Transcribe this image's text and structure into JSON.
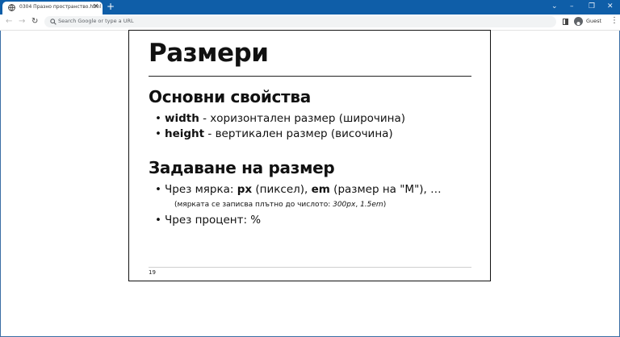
{
  "browser": {
    "tab_title": "0304 Празно пространство.html",
    "tab_close": "×",
    "new_tab": "+",
    "address_placeholder": "Search Google or type a URL",
    "profile_label": "Guest",
    "window_controls": {
      "minimize": "–",
      "restore": "❐",
      "close": "✕",
      "dropdown": "⌄"
    },
    "nav": {
      "back": "←",
      "forward": "→",
      "reload": "↻"
    },
    "menu": "⋮"
  },
  "slide": {
    "title": "Размери",
    "section1": {
      "heading": "Основни свойства",
      "bullets": [
        {
          "term": "width",
          "rest": " - хоризонтален размер (широчина)"
        },
        {
          "term": "height",
          "rest": " - вертикален размер (височина)"
        }
      ]
    },
    "section2": {
      "heading": "Задаване на размер",
      "bullet1": {
        "t1": "Чрез мярка: ",
        "b1": "px",
        "t2": " (пиксел), ",
        "b2": "em",
        "t3": " (размер на \"M\"), …"
      },
      "note": {
        "prefix": "(мярката се записва плътно до числото: ",
        "ex1": "300px",
        "sep": ", ",
        "ex2": "1.5em",
        "suffix": ")"
      },
      "bullet2": "Чрез процент: %"
    },
    "page_number": "19"
  }
}
